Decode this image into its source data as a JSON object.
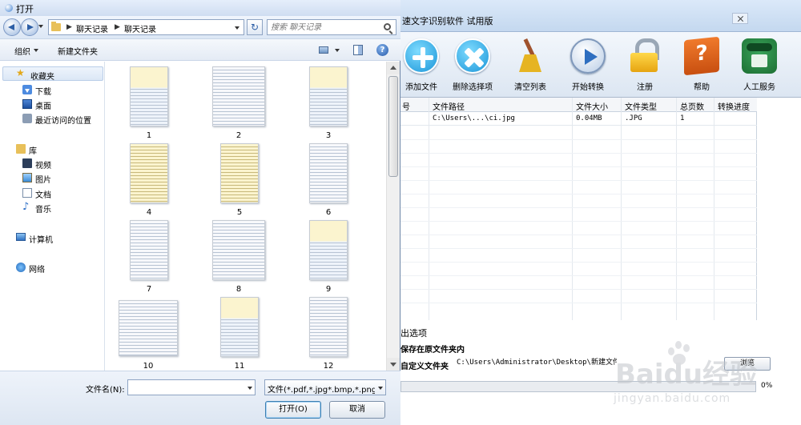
{
  "app": {
    "title": "速文字识别软件 试用版",
    "toolbar": {
      "add_file": "添加文件",
      "delete_selected": "删除选择项",
      "clear_list": "清空列表",
      "start_convert": "开始转换",
      "register": "注册",
      "help": "帮助",
      "service": "人工服务"
    },
    "table": {
      "headers": [
        "号",
        "文件路径",
        "文件大小",
        "文件类型",
        "总页数",
        "转换进度"
      ],
      "rows": [
        {
          "path": "C:\\Users\\...\\ci.jpg",
          "size": "0.04MB",
          "type": ".JPG",
          "pages": "1",
          "progress": ""
        }
      ]
    },
    "options": {
      "title": "出选项",
      "save_same": "保存在原文件夹内",
      "custom_folder": "自定义文件夹",
      "custom_path": "C:\\Users\\Administrator\\Desktop\\新建文件夹",
      "browse": "浏览",
      "progress_text": "0%",
      "progress_value": 0
    }
  },
  "dialog": {
    "title": "打开",
    "breadcrumb": [
      "聊天记录",
      "聊天记录"
    ],
    "search_placeholder": "搜索 聊天记录",
    "organize": "组织",
    "new_folder": "新建文件夹",
    "nav": {
      "favorites": "收藏夹",
      "downloads": "下载",
      "desktop": "桌面",
      "recent": "最近访问的位置",
      "libraries": "库",
      "videos": "视频",
      "pictures": "图片",
      "documents": "文档",
      "music": "音乐",
      "computer": "计算机",
      "network": "网络"
    },
    "files": [
      "1",
      "2",
      "3",
      "4",
      "5",
      "6",
      "7",
      "8",
      "9",
      "10",
      "11",
      "12"
    ],
    "filename_label": "文件名(N):",
    "filename_value": "",
    "filetype": "文件(*.pdf,*.jpg*.bmp,*.png,*",
    "open_button": "打开(O)",
    "cancel_button": "取消"
  },
  "watermark": {
    "brand": "Baidu经验",
    "url": "jingyan.baidu.com"
  }
}
